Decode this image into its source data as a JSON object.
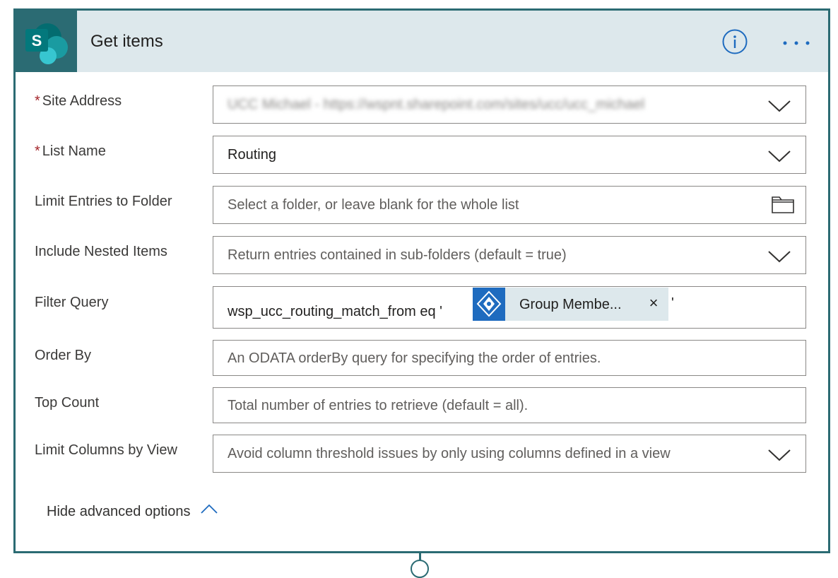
{
  "header": {
    "title": "Get items",
    "app_icon": "sharepoint-icon",
    "app_icon_letter": "S",
    "info_icon": "info-icon",
    "more_icon": "more-icon"
  },
  "fields": {
    "site_address": {
      "label": "Site Address",
      "required": "*",
      "value": "UCC Michael - https://wspnt.sharepoint.com/sites/ucc/ucc_michael"
    },
    "list_name": {
      "label": "List Name",
      "required": "*",
      "value": "Routing"
    },
    "limit_folder": {
      "label": "Limit Entries to Folder",
      "placeholder": "Select a folder, or leave blank for the whole list"
    },
    "nested_items": {
      "label": "Include Nested Items",
      "placeholder": "Return entries contained in sub-folders (default = true)"
    },
    "filter_query": {
      "label": "Filter Query",
      "text_before": "wsp_ucc_routing_match_from eq '",
      "token_label": "Group Membe...",
      "token_remove": "×",
      "text_after": "'"
    },
    "order_by": {
      "label": "Order By",
      "placeholder": "An ODATA orderBy query for specifying the order of entries."
    },
    "top_count": {
      "label": "Top Count",
      "placeholder": "Total number of entries to retrieve (default = all)."
    },
    "limit_columns": {
      "label": "Limit Columns by View",
      "placeholder": "Avoid column threshold issues by only using columns defined in a view"
    }
  },
  "advanced": {
    "label": "Hide advanced options"
  },
  "colors": {
    "accent": "#2b6b73",
    "header_bg": "#dde8ec",
    "link_blue": "#1e6bbf",
    "required_red": "#a4262c"
  }
}
